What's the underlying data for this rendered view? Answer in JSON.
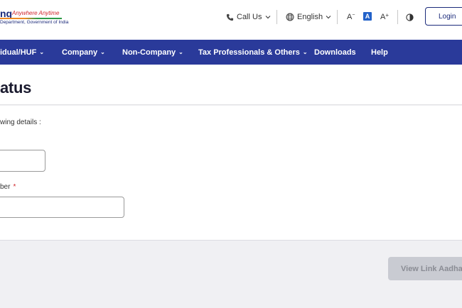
{
  "header": {
    "logo_text": "ng",
    "logo_tagline": "Anywhere Anytime",
    "logo_subtitle": "Department, Government of India",
    "call_us": "Call Us",
    "language": "English",
    "font_decrease": "A",
    "font_normal": "A",
    "font_increase": "A",
    "login": "Login"
  },
  "nav": {
    "items": [
      {
        "label": "idual/HUF",
        "has_dropdown": true
      },
      {
        "label": "Company",
        "has_dropdown": true
      },
      {
        "label": "Non-Company",
        "has_dropdown": true
      },
      {
        "label": "Tax Professionals & Others",
        "has_dropdown": true
      },
      {
        "label": "Downloads",
        "has_dropdown": false
      },
      {
        "label": "Help",
        "has_dropdown": false
      }
    ]
  },
  "page": {
    "title": "atus"
  },
  "form": {
    "instruction": "wing details :",
    "field2_label": "ber",
    "required_marker": "*",
    "submit_label": "View Link Aadhaar Status"
  },
  "colors": {
    "nav_bg": "#2a3a9a",
    "brand": "#1b2a7a",
    "accent": "#d0262c",
    "active_font": "#2362c9",
    "disabled_btn": "#c9cbd2"
  }
}
